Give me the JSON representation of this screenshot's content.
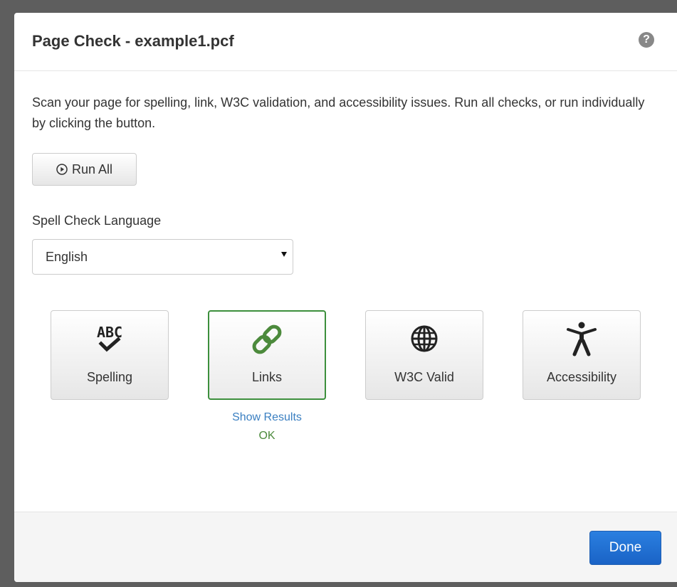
{
  "dialog": {
    "title": "Page Check - example1.pcf",
    "help_icon": "?",
    "description": "Scan your page for spelling, link, W3C validation, and accessibility issues. Run all checks, or run individually by clicking the button.",
    "run_all_label": "Run All"
  },
  "language": {
    "label": "Spell Check Language",
    "selected": "English"
  },
  "checks": [
    {
      "label": "Spelling",
      "icon": "abc-check-icon"
    },
    {
      "label": "Links",
      "icon": "link-icon",
      "active": true
    },
    {
      "label": "W3C Valid",
      "icon": "globe-icon"
    },
    {
      "label": "Accessibility",
      "icon": "accessibility-icon"
    }
  ],
  "results": {
    "links": {
      "show_results": "Show Results",
      "status": "OK"
    }
  },
  "footer": {
    "done_label": "Done"
  },
  "colors": {
    "accent_blue": "#1a63c6",
    "active_green": "#3c8f3c",
    "link_blue": "#3a7fc1",
    "status_green": "#4c8a3c"
  }
}
